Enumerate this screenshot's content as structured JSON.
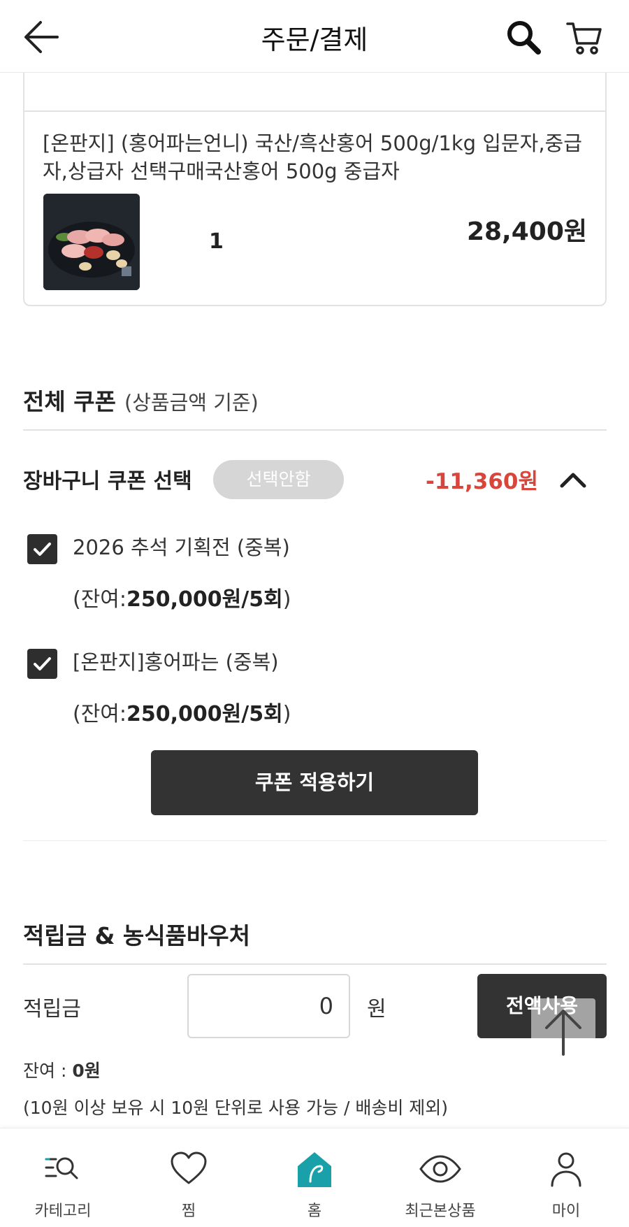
{
  "header": {
    "title": "주문/결제"
  },
  "product": {
    "name": "[온판지] (홍어파는언니) 국산/흑산홍어 500g/1kg 입문자,중급자,상급자 선택구매국산홍어 500g 중급자",
    "quantity": "1",
    "price": "28,400원"
  },
  "coupon_section": {
    "title": "전체 쿠폰",
    "subtitle": "(상품금액 기준)",
    "cart_coupon_label": "장바구니 쿠폰 선택",
    "pill_label": "선택안함",
    "discount": "-11,360원",
    "coupons": [
      {
        "name": "2026 추석 기획전 (중복)",
        "remain_prefix": "(잔여:",
        "remain_value": "250,000원/5회",
        "remain_suffix": ")",
        "checked": true
      },
      {
        "name": "[온판지]홍어파는 (중복)",
        "remain_prefix": "(잔여:",
        "remain_value": "250,000원/5회",
        "remain_suffix": ")",
        "checked": true
      }
    ],
    "apply_button": "쿠폰 적용하기"
  },
  "points_section": {
    "title": "적립금 & 농식품바우처",
    "points_label": "적립금",
    "points_value": "0",
    "unit": "원",
    "use_all_button": "전액사용",
    "remain_prefix": "잔여 : ",
    "remain_value": "0원",
    "note": "(10원 이상 보유 시 10원 단위로 사용 가능 / 배송비 제외)"
  },
  "tabbar": {
    "items": [
      {
        "label": "카테고리",
        "icon": "category-search-icon"
      },
      {
        "label": "찜",
        "icon": "heart-icon"
      },
      {
        "label": "홈",
        "icon": "home-logo-icon"
      },
      {
        "label": "최근본상품",
        "icon": "eye-icon"
      },
      {
        "label": "마이",
        "icon": "person-icon"
      }
    ]
  },
  "colors": {
    "accent_dark": "#333333",
    "discount_red": "#d9443b",
    "home_teal": "#1aa0a8"
  }
}
